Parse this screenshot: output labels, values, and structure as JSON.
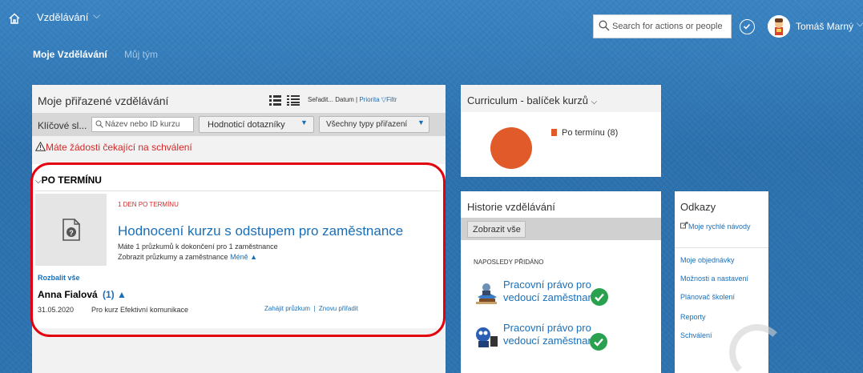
{
  "header": {
    "app_title": "Vzdělávání",
    "search_placeholder": "Search for actions or people",
    "user_name": "Tomáš Marný",
    "nav": {
      "my_learning": "Moje Vzdělávání",
      "my_team": "Můj tým"
    }
  },
  "assigned": {
    "title": "Moje přiřazené vzdělávání",
    "sort": {
      "prefix": "Seřadit... Datum |",
      "priority": "Priorita",
      "filter": "Filtr"
    },
    "filters": {
      "keyword_label": "Klíčové sl...",
      "name_placeholder": "Název nebo ID kurzu",
      "eval_dropdown": "Hodnoticí dotazníky",
      "types_dropdown": "Všechny typy přiřazení"
    },
    "warning": "Máte žádosti čekající na schválení",
    "section_header": "PO TERMÍNU",
    "item": {
      "due_label": "1 DEN PO TERMÍNU",
      "title": "Hodnocení kurzu s odstupem pro zaměstnance",
      "line1": "Máte 1 průzkumů k dokončení pro 1 zaměstnance",
      "line2": "Zobrazit průzkumy a zaměstnance",
      "less": "Méně ▲"
    },
    "expand_all": "Rozbalit vše",
    "person": {
      "name": "Anna Fialová",
      "count": "(1) ▲"
    },
    "row": {
      "date": "31.05.2020",
      "course": "Pro kurz Efektivní komunikace",
      "start_survey": "Zahájit průzkum",
      "separator": "|",
      "reassign": "Znovu přiřadit"
    }
  },
  "curriculum": {
    "title": "Curriculum - balíček kurzů",
    "legend": "Po termínu (8)"
  },
  "chart_data": {
    "type": "pie",
    "categories": [
      "Po termínu"
    ],
    "values": [
      8
    ],
    "colors": [
      "#e05a2a"
    ]
  },
  "history": {
    "title": "Historie vzdělávání",
    "show_all": "Zobrazit vše",
    "recent_label": "NAPOSLEDY PŘIDÁNO",
    "items": [
      {
        "line1": "Pracovní právo pro",
        "line2": "vedoucí zaměstnanc.."
      },
      {
        "line1": "Pracovní právo pro",
        "line2": "vedoucí zaměstnanc..."
      }
    ]
  },
  "links": {
    "title": "Odkazy",
    "quick_guides": "Moje rychlé návody",
    "orders": "Moje objednávky",
    "options": "Možnosti a nastavení",
    "planner": "Plánovač školení",
    "reports": "Reporty",
    "approvals": "Schválení"
  },
  "colors": {
    "accent": "#1a6fb8",
    "alert": "#d12a2a",
    "highlight": "#e3000f",
    "success": "#2aa14f",
    "chart": "#e05a2a"
  }
}
